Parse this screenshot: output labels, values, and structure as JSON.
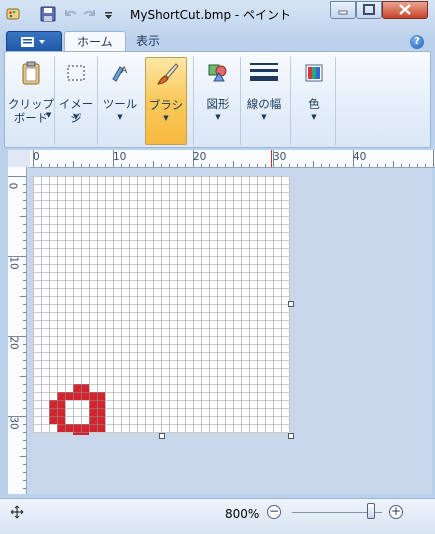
{
  "window": {
    "title": "MyShortCut.bmp - ペイント",
    "min_icon": "minimize-icon",
    "max_icon": "maximize-icon",
    "close_icon": "close-icon"
  },
  "tabs": [
    {
      "label": "ホーム",
      "active": true
    },
    {
      "label": "表示",
      "active": false
    }
  ],
  "ribbon": {
    "clipboard": {
      "label1": "クリップ",
      "label2": "ボード",
      "icon": "clipboard-icon"
    },
    "image": {
      "label": "イメージ",
      "icon": "select-icon"
    },
    "tools": {
      "label": "ツール",
      "icon": "tools-icon"
    },
    "brushes": {
      "label": "ブラシ",
      "icon": "brush-icon",
      "selected": true
    },
    "shapes": {
      "label": "図形",
      "icon": "shapes-icon"
    },
    "size": {
      "label": "線の幅",
      "icon": "line-width-icon"
    },
    "colors": {
      "label": "色",
      "icon": "colors-icon"
    }
  },
  "ruler": {
    "top_labels": [
      "0",
      "10",
      "20",
      "30",
      "40"
    ],
    "left_labels": [
      "0",
      "10",
      "20",
      "30"
    ]
  },
  "canvas": {
    "grid_color": "#9a9a9a",
    "pixel_color": "#d2222d",
    "painted_pixels": [
      [
        5,
        26
      ],
      [
        6,
        26
      ],
      [
        3,
        27
      ],
      [
        4,
        27
      ],
      [
        5,
        27
      ],
      [
        6,
        27
      ],
      [
        7,
        27
      ],
      [
        8,
        27
      ],
      [
        2,
        28
      ],
      [
        3,
        28
      ],
      [
        7,
        28
      ],
      [
        8,
        28
      ],
      [
        2,
        29
      ],
      [
        3,
        29
      ],
      [
        7,
        29
      ],
      [
        8,
        29
      ],
      [
        2,
        30
      ],
      [
        3,
        30
      ],
      [
        7,
        30
      ],
      [
        8,
        30
      ],
      [
        3,
        31
      ],
      [
        4,
        31
      ],
      [
        5,
        31
      ],
      [
        6,
        31
      ],
      [
        7,
        31
      ],
      [
        8,
        31
      ],
      [
        5,
        32
      ],
      [
        6,
        32
      ]
    ]
  },
  "status": {
    "zoom": "800%",
    "zoom_minus": "−",
    "zoom_plus": "+"
  },
  "colors": {
    "accent": "#1f58a8",
    "brush_selected": "#f9c95a"
  }
}
